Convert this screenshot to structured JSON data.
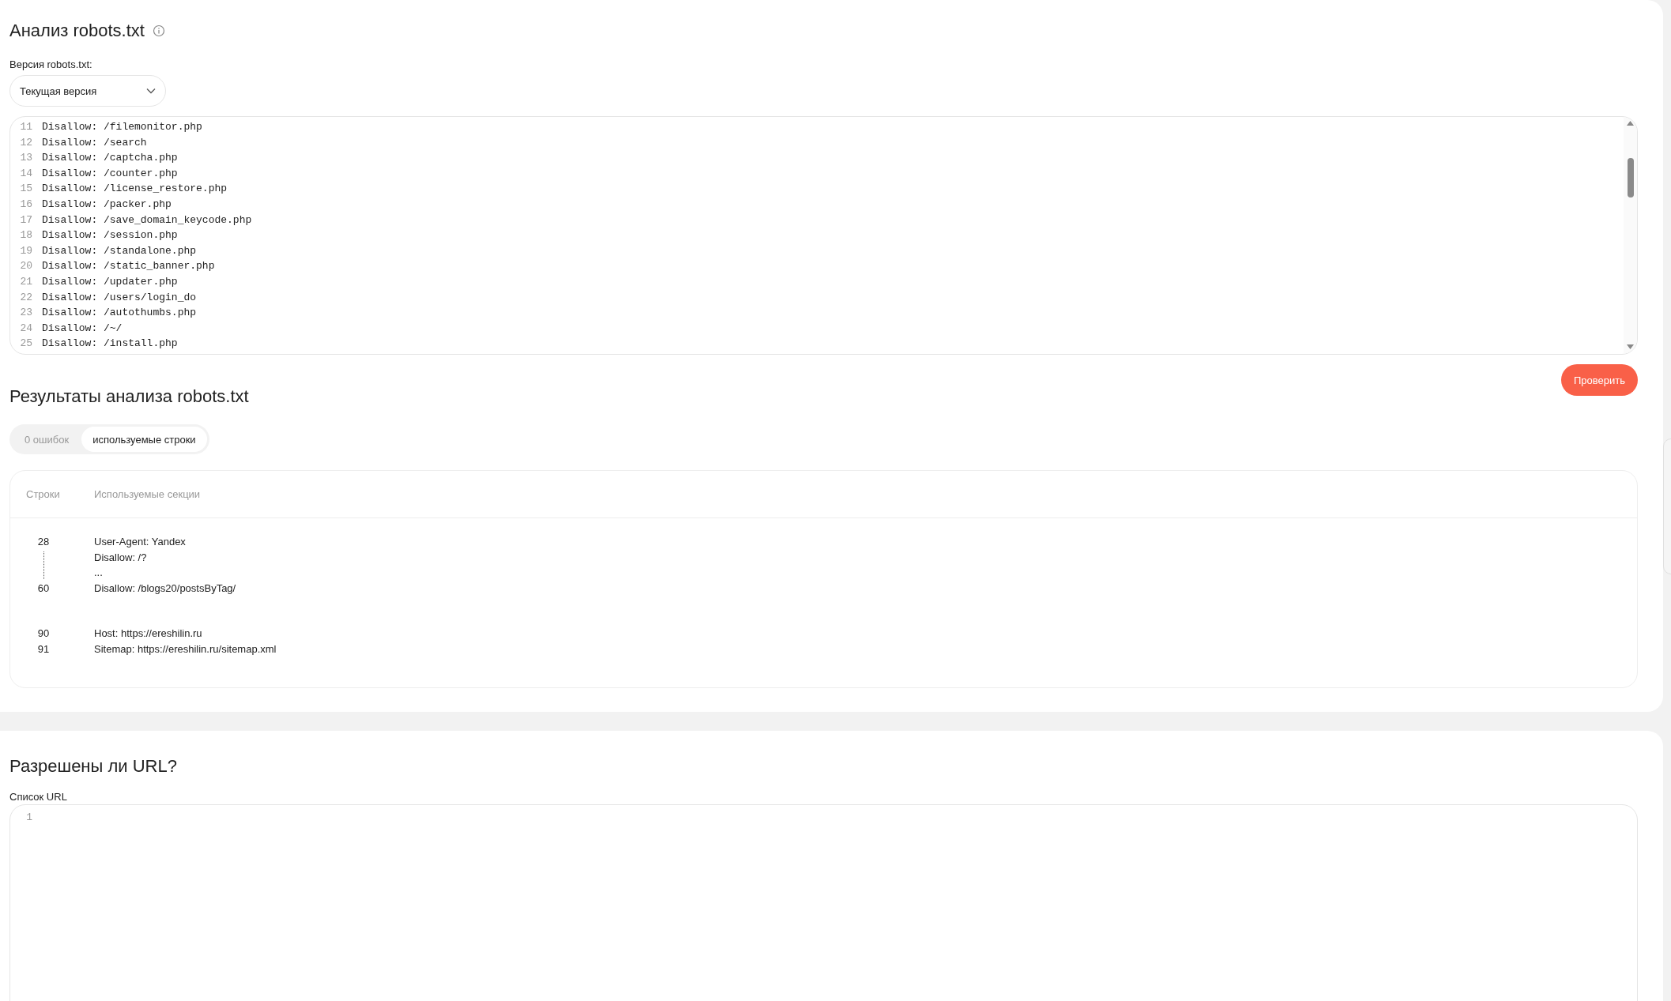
{
  "analysis": {
    "title": "Анализ robots.txt",
    "version_label": "Версия robots.txt:",
    "version_select": {
      "value": "Текущая версия"
    },
    "editor_lines": [
      {
        "number": "11",
        "text": "Disallow: /filemonitor.php"
      },
      {
        "number": "12",
        "text": "Disallow: /search"
      },
      {
        "number": "13",
        "text": "Disallow: /captcha.php"
      },
      {
        "number": "14",
        "text": "Disallow: /counter.php"
      },
      {
        "number": "15",
        "text": "Disallow: /license_restore.php"
      },
      {
        "number": "16",
        "text": "Disallow: /packer.php"
      },
      {
        "number": "17",
        "text": "Disallow: /save_domain_keycode.php"
      },
      {
        "number": "18",
        "text": "Disallow: /session.php"
      },
      {
        "number": "19",
        "text": "Disallow: /standalone.php"
      },
      {
        "number": "20",
        "text": "Disallow: /static_banner.php"
      },
      {
        "number": "21",
        "text": "Disallow: /updater.php"
      },
      {
        "number": "22",
        "text": "Disallow: /users/login_do"
      },
      {
        "number": "23",
        "text": "Disallow: /autothumbs.php"
      },
      {
        "number": "24",
        "text": "Disallow: /~/"
      },
      {
        "number": "25",
        "text": "Disallow: /install.php"
      }
    ],
    "check_button": "Проверить"
  },
  "results": {
    "title": "Результаты анализа robots.txt",
    "tabs": [
      {
        "label": "0 ошибок",
        "selected": false
      },
      {
        "label": "используемые строки",
        "selected": true
      }
    ],
    "columns": [
      "Строки",
      "Используемые секции"
    ],
    "sections": [
      {
        "kind": "range",
        "start": "28",
        "end": "60",
        "lines": [
          "User-Agent: Yandex",
          "Disallow: /?",
          "...",
          "Disallow: /blogs20/postsByTag/"
        ]
      },
      {
        "kind": "list",
        "rows": [
          {
            "number": "90",
            "text": "Host: https://ereshilin.ru"
          },
          {
            "number": "91",
            "text": "Sitemap: https://ereshilin.ru/sitemap.xml"
          }
        ]
      }
    ]
  },
  "url_check": {
    "title": "Разрешены ли URL?",
    "list_label": "Список URL",
    "editor_lines": [
      {
        "number": "1"
      }
    ]
  }
}
